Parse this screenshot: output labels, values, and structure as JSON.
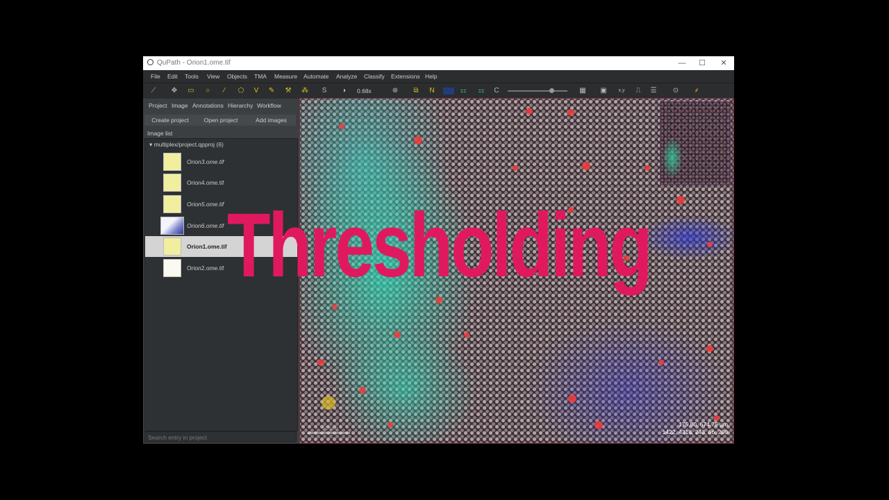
{
  "window": {
    "title": "QuPath - Orion1.ome.tif",
    "controls": {
      "minimize": "—",
      "maximize": "☐",
      "close": "✕"
    }
  },
  "menu": [
    "File",
    "Edit",
    "Tools",
    "View",
    "Objects",
    "TMA",
    "Measure",
    "Automate",
    "Analyze",
    "Classify",
    "Extensions",
    "Help"
  ],
  "toolbar": {
    "tools": [
      "measure-icon",
      "move-icon",
      "rectangle-icon",
      "ellipse-icon",
      "line-icon",
      "polygon-icon",
      "polyline-icon",
      "brush-icon",
      "wand-icon",
      "points-icon",
      "selection-mode-icon",
      "contrast-icon"
    ],
    "zoom": "0.68x",
    "letters": {
      "selection": "S",
      "v": "V",
      "n": "N",
      "c": "C",
      "xy": "x,y"
    }
  },
  "panel": {
    "tabs": [
      "Project",
      "Image",
      "Annotations",
      "Hierarchy",
      "Workflow"
    ],
    "buttons": [
      "Create project",
      "Open project",
      "Add images"
    ],
    "list_label": "Image list",
    "root": "multiplex/project.qpproj (6)",
    "images": [
      {
        "name": "Orion3.ome.tif",
        "selected": false
      },
      {
        "name": "Orion4.ome.tif",
        "selected": false
      },
      {
        "name": "Orion5.ome.tif",
        "selected": false
      },
      {
        "name": "Orion6.ome.tif",
        "selected": false
      },
      {
        "name": "Orion1.ome.tif",
        "selected": true
      },
      {
        "name": "Orion2.ome.tif",
        "selected": false
      }
    ],
    "search_placeholder": "Search entry in project"
  },
  "viewer": {
    "scale_label": "50 µm",
    "coords_line1": "175.80, 674.75 µm",
    "coords_line2": "1422, 4318, 243, 66, 208"
  },
  "overlay_text": "Thresholding",
  "colors": {
    "overlay": "#e0195f",
    "tool_accent": "#d8c320",
    "selection_bg": "#d4d4d4"
  }
}
